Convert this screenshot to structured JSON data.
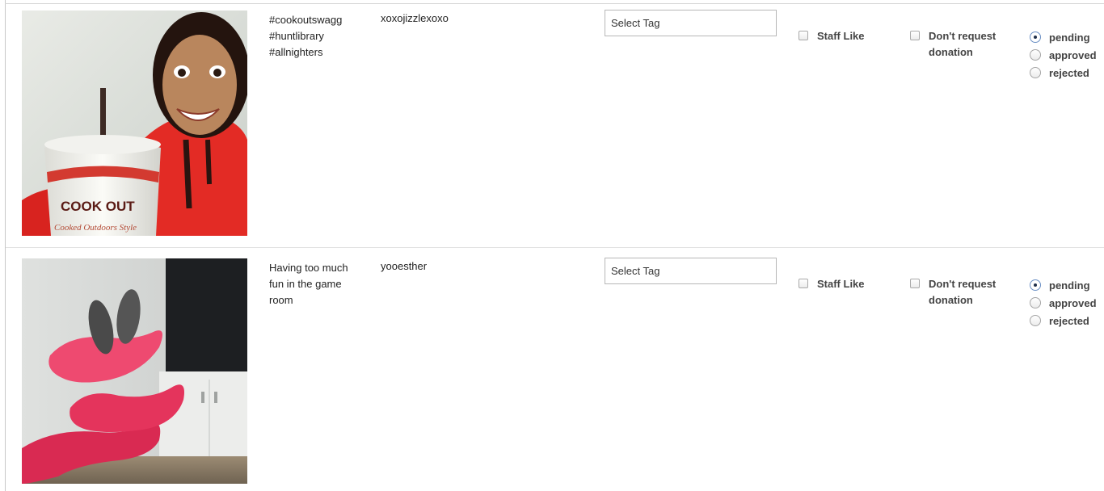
{
  "posts": [
    {
      "caption_lines": [
        "#cookoutswagg",
        "#huntlibrary",
        "#allnighters"
      ],
      "username": "xoxojizzlexoxo",
      "tag_select": "Select Tag",
      "staff_like": "Staff Like",
      "dont_request": "Don't request donation",
      "status_options": [
        "pending",
        "approved",
        "rejected"
      ],
      "selected_status": "pending",
      "photo_text": {
        "cup_brand": "COOK OUT",
        "cup_slogan": "Cooked Outdoors Style"
      }
    },
    {
      "caption_lines": [
        "Having too much",
        "fun in the game",
        "room"
      ],
      "username": "yooesther",
      "tag_select": "Select Tag",
      "staff_like": "Staff Like",
      "dont_request": "Don't request donation",
      "status_options": [
        "pending",
        "approved",
        "rejected"
      ],
      "selected_status": "pending"
    }
  ],
  "colors": {
    "hoodie_red": "#e32b25",
    "chair_pink": "#e4345c",
    "radio_selected_dot": "#1f2f4a",
    "border": "#c8c8c8"
  }
}
